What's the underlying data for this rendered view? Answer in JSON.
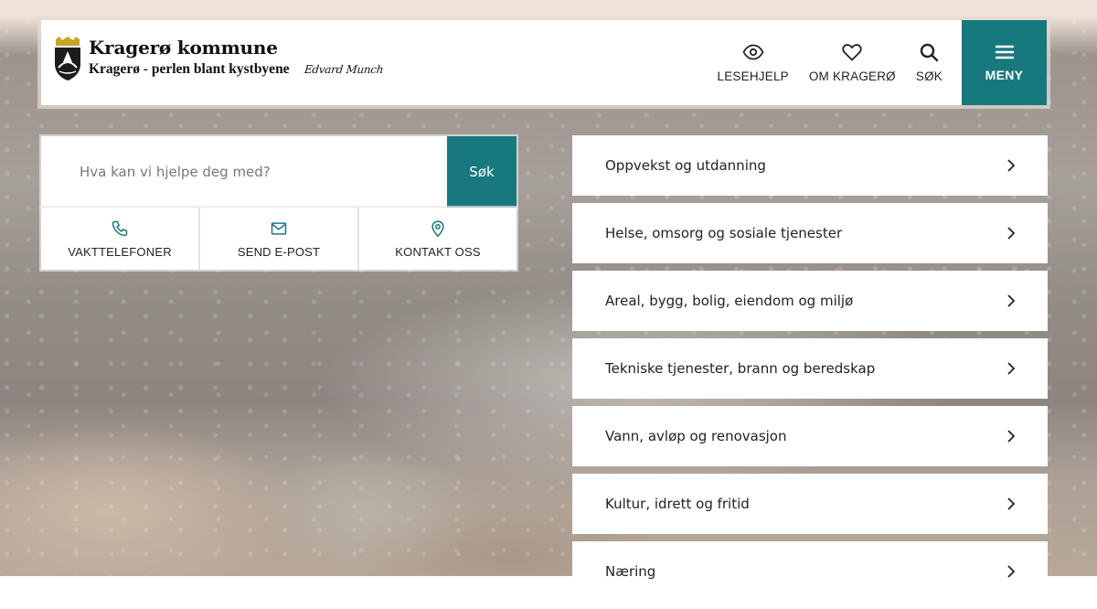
{
  "header": {
    "title": "Kragerø kommune",
    "tagline": "Kragerø - perlen blant kystbyene",
    "signature": "Edvard Munch",
    "nav": [
      {
        "label": "LESEHJELP",
        "icon": "eye-icon"
      },
      {
        "label": "OM KRAGERØ",
        "icon": "heart-icon"
      },
      {
        "label": "SØK",
        "icon": "search-icon"
      }
    ],
    "menu_label": "MENY"
  },
  "search": {
    "placeholder": "Hva kan vi hjelpe deg med?",
    "button": "Søk"
  },
  "quick_links": [
    {
      "label": "VAKTTELEFONER",
      "icon": "phone-icon"
    },
    {
      "label": "SEND E-POST",
      "icon": "mail-icon"
    },
    {
      "label": "KONTAKT OSS",
      "icon": "location-pin-icon"
    }
  ],
  "categories": [
    "Oppvekst og utdanning",
    "Helse, omsorg og sosiale tjenester",
    "Areal, bygg, bolig, eiendom og miljø",
    "Tekniske tjenester, brann og beredskap",
    "Vann, avløp og renovasjon",
    "Kultur, idrett og fritid",
    "Næring"
  ],
  "colors": {
    "accent": "#17787e",
    "panel": "#ffffff",
    "text": "#222222"
  }
}
